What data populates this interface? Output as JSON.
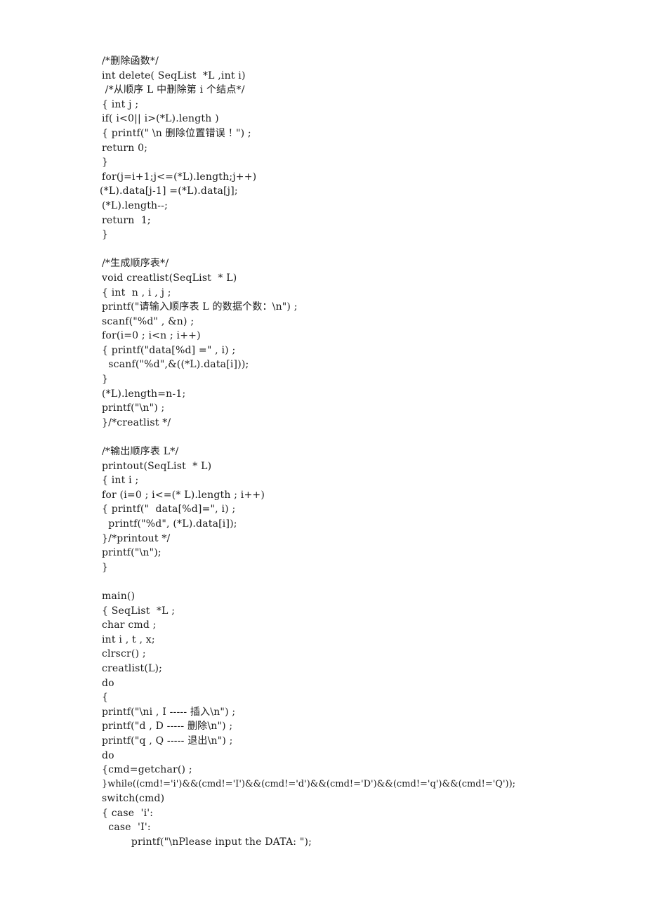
{
  "document": {
    "language": "C",
    "sections": [
      {
        "name": "delete-function",
        "lines": [
          "/*删除函数*/",
          "int delete( SeqList  *L ,int i)",
          " /*从顺序 L 中删除第 i 个结点*/",
          "{ int j ;",
          "if( i<0|| i>(*L).length )",
          "{ printf(\" \\n 删除位置错误 ! \") ;",
          "return 0;",
          "}",
          "for(j=i+1;j<=(*L).length;j++)",
          "(*L).data[j-1] =(*L).data[j];",
          "(*L).length--;",
          "return  1;",
          "}"
        ]
      },
      {
        "name": "creatlist-function",
        "lines": [
          "/*生成顺序表*/",
          "void creatlist(SeqList  * L)",
          "{ int  n , i , j ;",
          "printf(\"请输入顺序表 L 的数据个数：\\n\") ;",
          "scanf(\"%d\" , &n) ;",
          "for(i=0 ; i<n ; i++)",
          "{ printf(\"data[%d] =\" , i) ;",
          "  scanf(\"%d\",&((*L).data[i]));",
          "}",
          "(*L).length=n-1;",
          "printf(\"\\n\") ;",
          "}/*creatlist */"
        ]
      },
      {
        "name": "printout-function",
        "lines": [
          "/*输出顺序表 L*/",
          "printout(SeqList  * L)",
          "{ int i ;",
          "for (i=0 ; i<=(* L).length ; i++)",
          "{ printf(\"  data[%d]=\", i) ;",
          "  printf(\"%d\", (*L).data[i]);",
          "}/*printout */",
          "printf(\"\\n\");",
          "}"
        ]
      },
      {
        "name": "main-function",
        "lines": [
          "main()",
          "{ SeqList  *L ;",
          "char cmd ;",
          "int i , t , x;",
          "clrscr() ;",
          "creatlist(L);",
          "do",
          "{",
          "printf(\"\\ni , I ----- 插入\\n\") ;",
          "printf(\"d , D ----- 删除\\n\") ;",
          "printf(\"q , Q ----- 退出\\n\") ;",
          "do",
          "{cmd=getchar() ;",
          "}while((cmd!='i')&&(cmd!='I')&&(cmd!='d')&&(cmd!='D')&&(cmd!='q')&&(cmd!='Q'));",
          "switch(cmd)",
          "{ case  'i':",
          "  case  'I':",
          "         printf(\"\\nPlease input the DATA: \");"
        ]
      }
    ]
  }
}
